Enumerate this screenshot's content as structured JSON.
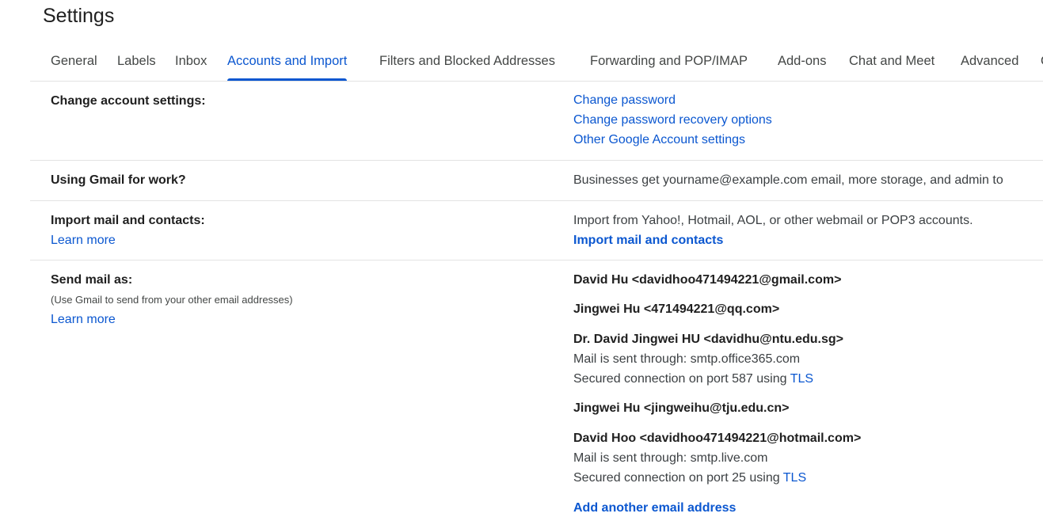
{
  "title": "Settings",
  "tabs": [
    "General",
    "Labels",
    "Inbox",
    "Accounts and Import",
    "Filters and Blocked Addresses",
    "Forwarding and POP/IMAP",
    "Add-ons",
    "Chat and Meet",
    "Advanced",
    "O"
  ],
  "change_account": {
    "label": "Change account settings:",
    "links": [
      "Change password",
      "Change password recovery options",
      "Other Google Account settings"
    ]
  },
  "work": {
    "label": "Using Gmail for work?",
    "text": "Businesses get yourname@example.com email, more storage, and admin to"
  },
  "import": {
    "label": "Import mail and contacts:",
    "learn_more": "Learn more",
    "text": "Import from Yahoo!, Hotmail, AOL, or other webmail or POP3 accounts.",
    "action": "Import mail and contacts"
  },
  "send_as": {
    "label": "Send mail as:",
    "note": "(Use Gmail to send from your other email addresses)",
    "learn_more": "Learn more",
    "accounts": [
      {
        "name": "David Hu <davidhoo471494221@gmail.com>"
      },
      {
        "name": "Jingwei Hu <471494221@qq.com>"
      },
      {
        "name": "Dr. David Jingwei HU <davidhu@ntu.edu.sg>",
        "through": "Mail is sent through: smtp.office365.com",
        "secured": "Secured connection on port 587 using ",
        "tls": "TLS"
      },
      {
        "name": "Jingwei Hu <jingweihu@tju.edu.cn>"
      },
      {
        "name": "David Hoo <davidhoo471494221@hotmail.com>",
        "through": "Mail is sent through: smtp.live.com",
        "secured": "Secured connection on port 25 using ",
        "tls": "TLS"
      }
    ],
    "add_link": "Add another email address"
  },
  "colors": {
    "accent": "#0b57d0",
    "divider": "#e3e3e3",
    "text": "#1f1f1f"
  }
}
